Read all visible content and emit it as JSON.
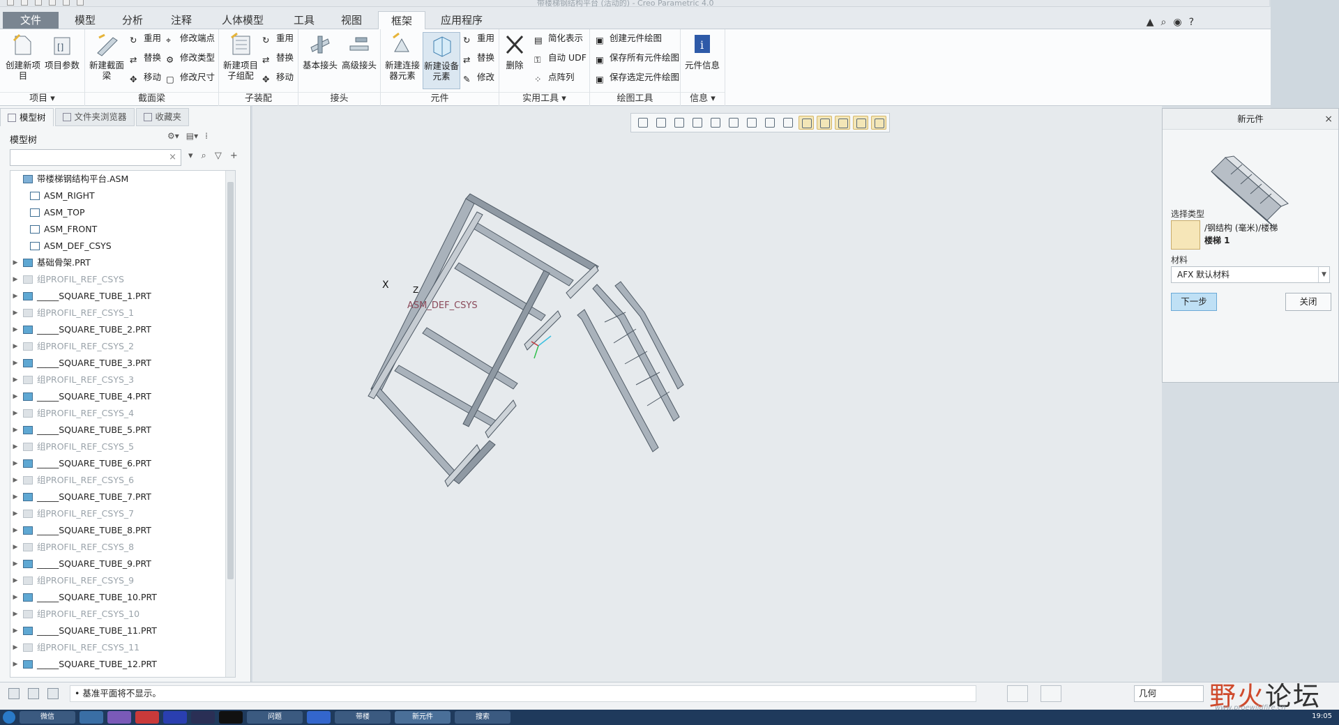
{
  "window": {
    "title": "带楼梯钢结构平台 (活动的) - Creo Parametric 4.0"
  },
  "tabs": [
    {
      "label": "文件"
    },
    {
      "label": "模型"
    },
    {
      "label": "分析"
    },
    {
      "label": "注释"
    },
    {
      "label": "人体模型"
    },
    {
      "label": "工具"
    },
    {
      "label": "视图"
    },
    {
      "label": "框架"
    },
    {
      "label": "应用程序"
    }
  ],
  "ribbon": {
    "g1": {
      "b1": "创建新项目",
      "b2": "项目参数",
      "label": "项目"
    },
    "g2": {
      "b1": "新建截面梁",
      "s1": "重用",
      "s2": "替换",
      "s3": "移动",
      "s4": "修改端点",
      "s5": "修改类型",
      "s6": "修改尺寸",
      "label": "截面梁"
    },
    "g3": {
      "b1": "新建项目子组配",
      "s1": "重用",
      "s2": "替换",
      "s3": "移动",
      "label": "子装配"
    },
    "g4": {
      "b1": "基本接头",
      "b2": "高级接头",
      "label": "接头"
    },
    "g5": {
      "b1": "新建连接器元素",
      "b2": "新建设备元素",
      "s1": "重用",
      "s2": "替换",
      "s3": "修改",
      "label": "元件"
    },
    "g6": {
      "b1": "删除",
      "s1": "简化表示",
      "s2": "自动 UDF",
      "s3": "点阵列",
      "label": "实用工具"
    },
    "g7": {
      "s1": "创建元件绘图",
      "s2": "保存所有元件绘图",
      "s3": "保存选定元件绘图",
      "label": "绘图工具"
    },
    "g8": {
      "b1": "元件信息",
      "label": "信息"
    }
  },
  "panel": {
    "tabs": [
      {
        "label": "模型树"
      },
      {
        "label": "文件夹浏览器"
      },
      {
        "label": "收藏夹"
      }
    ],
    "tree_header": "模型树",
    "search_value": "",
    "tree": [
      {
        "label": "带楼梯钢结构平台.ASM",
        "dim": false,
        "expand": false
      },
      {
        "label": "ASM_RIGHT",
        "dim": false,
        "expand": false
      },
      {
        "label": "ASM_TOP",
        "dim": false,
        "expand": false
      },
      {
        "label": "ASM_FRONT",
        "dim": false,
        "expand": false
      },
      {
        "label": "ASM_DEF_CSYS",
        "dim": false,
        "expand": false
      },
      {
        "label": "基础骨架.PRT",
        "dim": false,
        "expand": true
      },
      {
        "label": "组PROFIL_REF_CSYS",
        "dim": true,
        "expand": true
      },
      {
        "label": "_____SQUARE_TUBE_1.PRT",
        "dim": false,
        "expand": true
      },
      {
        "label": "组PROFIL_REF_CSYS_1",
        "dim": true,
        "expand": true
      },
      {
        "label": "_____SQUARE_TUBE_2.PRT",
        "dim": false,
        "expand": true
      },
      {
        "label": "组PROFIL_REF_CSYS_2",
        "dim": true,
        "expand": true
      },
      {
        "label": "_____SQUARE_TUBE_3.PRT",
        "dim": false,
        "expand": true
      },
      {
        "label": "组PROFIL_REF_CSYS_3",
        "dim": true,
        "expand": true
      },
      {
        "label": "_____SQUARE_TUBE_4.PRT",
        "dim": false,
        "expand": true
      },
      {
        "label": "组PROFIL_REF_CSYS_4",
        "dim": true,
        "expand": true
      },
      {
        "label": "_____SQUARE_TUBE_5.PRT",
        "dim": false,
        "expand": true
      },
      {
        "label": "组PROFIL_REF_CSYS_5",
        "dim": true,
        "expand": true
      },
      {
        "label": "_____SQUARE_TUBE_6.PRT",
        "dim": false,
        "expand": true
      },
      {
        "label": "组PROFIL_REF_CSYS_6",
        "dim": true,
        "expand": true
      },
      {
        "label": "_____SQUARE_TUBE_7.PRT",
        "dim": false,
        "expand": true
      },
      {
        "label": "组PROFIL_REF_CSYS_7",
        "dim": true,
        "expand": true
      },
      {
        "label": "_____SQUARE_TUBE_8.PRT",
        "dim": false,
        "expand": true
      },
      {
        "label": "组PROFIL_REF_CSYS_8",
        "dim": true,
        "expand": true
      },
      {
        "label": "_____SQUARE_TUBE_9.PRT",
        "dim": false,
        "expand": true
      },
      {
        "label": "组PROFIL_REF_CSYS_9",
        "dim": true,
        "expand": true
      },
      {
        "label": "_____SQUARE_TUBE_10.PRT",
        "dim": false,
        "expand": true
      },
      {
        "label": "组PROFIL_REF_CSYS_10",
        "dim": true,
        "expand": true
      },
      {
        "label": "_____SQUARE_TUBE_11.PRT",
        "dim": false,
        "expand": true
      },
      {
        "label": "组PROFIL_REF_CSYS_11",
        "dim": true,
        "expand": true
      },
      {
        "label": "_____SQUARE_TUBE_12.PRT",
        "dim": false,
        "expand": true
      }
    ]
  },
  "viewport": {
    "csys_label": "ASM_DEF_CSYS",
    "axis_x": "X",
    "axis_z": "Z"
  },
  "dialog": {
    "title": "新元件",
    "select_type_label": "选择类型",
    "type_path": "/钢结构 (毫米)/楼梯",
    "type_name": "楼梯 1",
    "material_label": "材料",
    "material_value": "AFX 默认材料",
    "next_button": "下一步",
    "close_button": "关闭"
  },
  "status": {
    "message": "• 基准平面将不显示。",
    "filter": "几何"
  },
  "watermark": {
    "text_red": "野火",
    "text_dark": "论坛",
    "url": "www.proewildfire.cn"
  },
  "taskbar": {
    "clock": "19:05",
    "items": [
      {
        "label": "微信"
      },
      {
        "label": "问题"
      },
      {
        "label": "带楼"
      },
      {
        "label": "新元件"
      },
      {
        "label": "搜索"
      }
    ]
  },
  "colors": {
    "file_tab": "#7a8591",
    "viewport_bg": "#e6eaed",
    "model_steel": "#9aa3ad",
    "accent_button": "#bfe0f5"
  }
}
